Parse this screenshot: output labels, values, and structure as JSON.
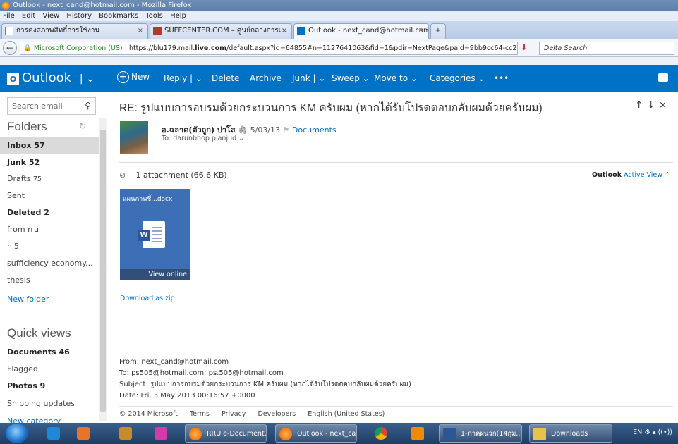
{
  "browser": {
    "window_title": "Outlook - next_cand@hotmail.com - Mozilla Firefox",
    "menu": [
      "File",
      "Edit",
      "View",
      "History",
      "Bookmarks",
      "Tools",
      "Help"
    ],
    "tabs": [
      {
        "label": "การคงสภาพสิทธิ์การใช้งาน",
        "active": false
      },
      {
        "label": "SUFFCENTER.COM – ศูนย์กลางการเ...",
        "active": false
      },
      {
        "label": "Outlook - next_cand@hotmail.com",
        "active": true
      }
    ],
    "new_tab": "+",
    "url_org": "Microsoft Corporation (US)",
    "url_prefix": "https://blu179.mail.",
    "url_domain": "live.com",
    "url_rest": "/default.aspx?id=64855#n=1127641063&fid=1&pdir=NextPage&paid=9bb9cc64-cc26",
    "search_placeholder": "Delta Search"
  },
  "outlook": {
    "brand": "Outlook",
    "commands": {
      "new": "New",
      "reply": "Reply",
      "delete": "Delete",
      "archive": "Archive",
      "junk": "Junk",
      "sweep": "Sweep",
      "move_to": "Move to",
      "categories": "Categories",
      "more": "•••"
    },
    "accent": "#0072c6"
  },
  "sidebar": {
    "search_placeholder": "Search email",
    "folders_title": "Folders",
    "folders": [
      {
        "label": "Inbox",
        "count": "57",
        "bold": true,
        "selected": true
      },
      {
        "label": "Junk",
        "count": "52",
        "bold": true
      },
      {
        "label": "Drafts",
        "count": "75"
      },
      {
        "label": "Sent",
        "count": ""
      },
      {
        "label": "Deleted",
        "count": "2",
        "bold": true
      },
      {
        "label": "from rru",
        "count": ""
      },
      {
        "label": "hi5",
        "count": ""
      },
      {
        "label": "sufficiency economy...",
        "count": ""
      },
      {
        "label": "thesis",
        "count": ""
      }
    ],
    "new_folder": "New folder",
    "quick_views_title": "Quick views",
    "quick_views": [
      {
        "label": "Documents",
        "count": "46",
        "bold": true
      },
      {
        "label": "Flagged",
        "count": ""
      },
      {
        "label": "Photos",
        "count": "9",
        "bold": true
      },
      {
        "label": "Shipping updates",
        "count": ""
      }
    ],
    "new_category": "New category"
  },
  "message": {
    "subject": "RE: รูปแบบการอบรมด้วยกระบวนการ KM ครับผม (หากได้รับโปรดตอบกลับผมด้วยครับผม)",
    "sender": "อ.ฉลาด(ตัวถูก) ปาโส",
    "date": "5/03/13",
    "category": "Documents",
    "to": "To: darunbhop pianjud",
    "attachment_summary": "1 attachment (66.6 KB)",
    "active_view_brand": "Outlook",
    "active_view_label": "Active View",
    "attachment": {
      "name": "แผนภาพชี้...docx",
      "view_online": "View online",
      "icon": "word-icon"
    },
    "download_zip": "Download as zip",
    "quoted": {
      "from": "From: next_cand@hotmail.com",
      "to": "To: ps505@hotmail.com; ps.505@hotmail.com",
      "subject": "Subject: รูปแบบการอบรมด้วยกระบวนการ KM ครับผม (หากได้รับโปรดตอบกลับผมด้วยครับผม)",
      "date": "Date: Fri, 3 May 2013 00:16:57 +0000"
    }
  },
  "footer": {
    "copyright": "© 2014 Microsoft",
    "links": [
      "Terms",
      "Privacy",
      "Developers",
      "English (United States)"
    ]
  },
  "taskbar": {
    "items": [
      {
        "label": "RRU e-Document..."
      },
      {
        "label": "Outlook - next_ca..."
      },
      {
        "label": "1-ภาคผนวก(14กุม..."
      },
      {
        "label": "Downloads"
      }
    ],
    "lang": "EN"
  }
}
